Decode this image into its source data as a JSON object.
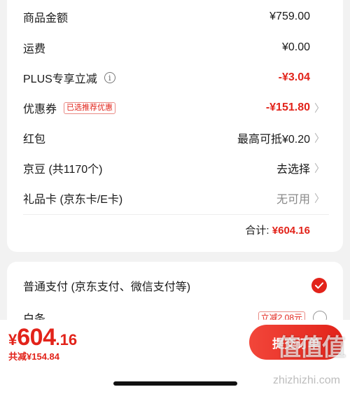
{
  "summary": {
    "rows": [
      {
        "label": "商品金额",
        "value": "¥759.00",
        "value_color": "#1a1a1a",
        "chevron": false
      },
      {
        "label": "运费",
        "value": "¥0.00",
        "value_color": "#1a1a1a",
        "chevron": false
      },
      {
        "label": "PLUS专享立减",
        "value": "-¥3.04",
        "value_color": "#e2231a",
        "chevron": false,
        "info_icon": true
      },
      {
        "label": "优惠券",
        "tag": "已选推荐优惠",
        "value": "-¥151.80",
        "value_color": "#e2231a",
        "chevron": true
      },
      {
        "label": "红包",
        "value": "最高可抵¥0.20",
        "value_color": "#1a1a1a",
        "chevron": true
      },
      {
        "label": "京豆 (共1170个)",
        "value": "去选择",
        "value_color": "#1a1a1a",
        "chevron": true
      },
      {
        "label": "礼品卡 (京东卡/E卡)",
        "value": "无可用",
        "value_color": "#888888",
        "chevron": true
      }
    ],
    "total_label": "合计:",
    "total_amount": "¥604.16"
  },
  "payment": {
    "normal_label": "普通支付 (京东支付、微信支付等)",
    "baitiao_label": "白条",
    "baitiao_tag": "立减2.08元"
  },
  "bottom": {
    "currency": "¥",
    "price_int": "604",
    "price_dec": ".16",
    "saved": "共减¥154.84",
    "submit_label": "提交订单",
    "watermark": "值值值",
    "watermark_url": "zhizhizhi.com"
  },
  "colors": {
    "accent": "#e2231a",
    "background": "#f2f2f2"
  },
  "icons": {
    "info": "info-icon",
    "chevron": "chevron-right-icon",
    "check": "check-circle-icon"
  }
}
